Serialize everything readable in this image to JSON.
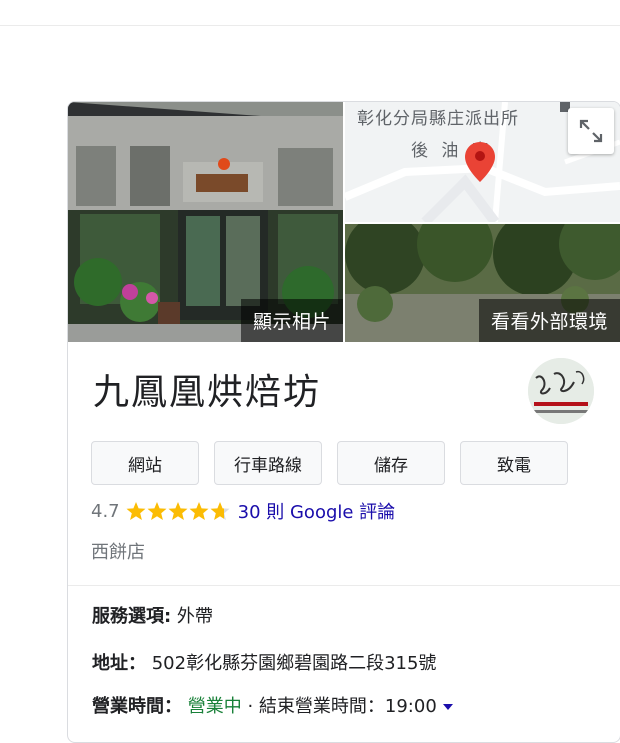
{
  "photos": {
    "main_label": "顯示相片",
    "street_label": "看看外部環境",
    "map_labels": [
      "彰化分局縣庄派出所",
      "後 油 車"
    ]
  },
  "business": {
    "name": "九鳳凰烘焙坊"
  },
  "actions": [
    "網站",
    "行車路線",
    "儲存",
    "致電"
  ],
  "rating": {
    "value": "4.7",
    "stars": 4.7,
    "reviews_link": "30 則 Google 評論"
  },
  "category": "西餅店",
  "info": {
    "service_key": "服務選項:",
    "service_val": " 外帶",
    "address_key": "地址：",
    "address_val": " 502彰化縣芬園鄉碧園路二段315號",
    "hours_key": "營業時間：",
    "hours_open": " 營業中",
    "hours_rest": " · 結束營業時間：19:00"
  },
  "colors": {
    "link": "#1a0dab",
    "open": "#188038",
    "star": "#fbbc04"
  }
}
